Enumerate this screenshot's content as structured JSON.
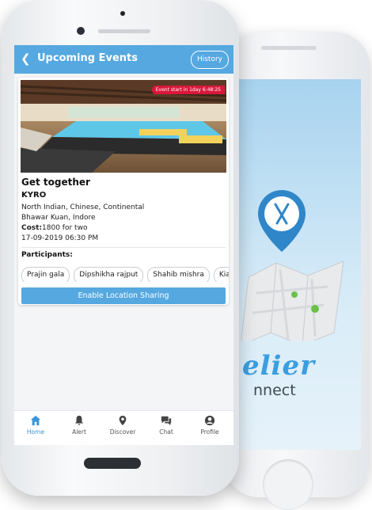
{
  "app": {
    "title": "Upcoming Events",
    "history_label": "History",
    "colors": {
      "primary": "#55a8e0",
      "badge": "#d9183b",
      "active_tab": "#3a95d6"
    }
  },
  "event": {
    "badge": "Event start in 1day 6:48:25",
    "title": "Get together",
    "venue": "KYRO",
    "cuisine": "North Indian, Chinese, Continental",
    "location": "Bhawar Kuan, Indore",
    "cost_label": "Cost:",
    "cost_value": "1800 for two",
    "datetime": "17-09-2019 06:30 PM"
  },
  "participants": {
    "label": "Participants:",
    "items": [
      "Prajin gala",
      "Dipshikha rajput",
      "Shahib mishra",
      "Kiar"
    ]
  },
  "enable_location_label": "Enable Location Sharing",
  "nav": {
    "items": [
      {
        "label": "Home",
        "icon": "home-icon",
        "active": true
      },
      {
        "label": "Alert",
        "icon": "bell-icon"
      },
      {
        "label": "Discover",
        "icon": "location-pin-icon"
      },
      {
        "label": "Chat",
        "icon": "chat-icon"
      },
      {
        "label": "Profile",
        "icon": "user-icon"
      }
    ]
  },
  "back_phone": {
    "brand_text": "elier",
    "brand_sub": "nnect"
  }
}
